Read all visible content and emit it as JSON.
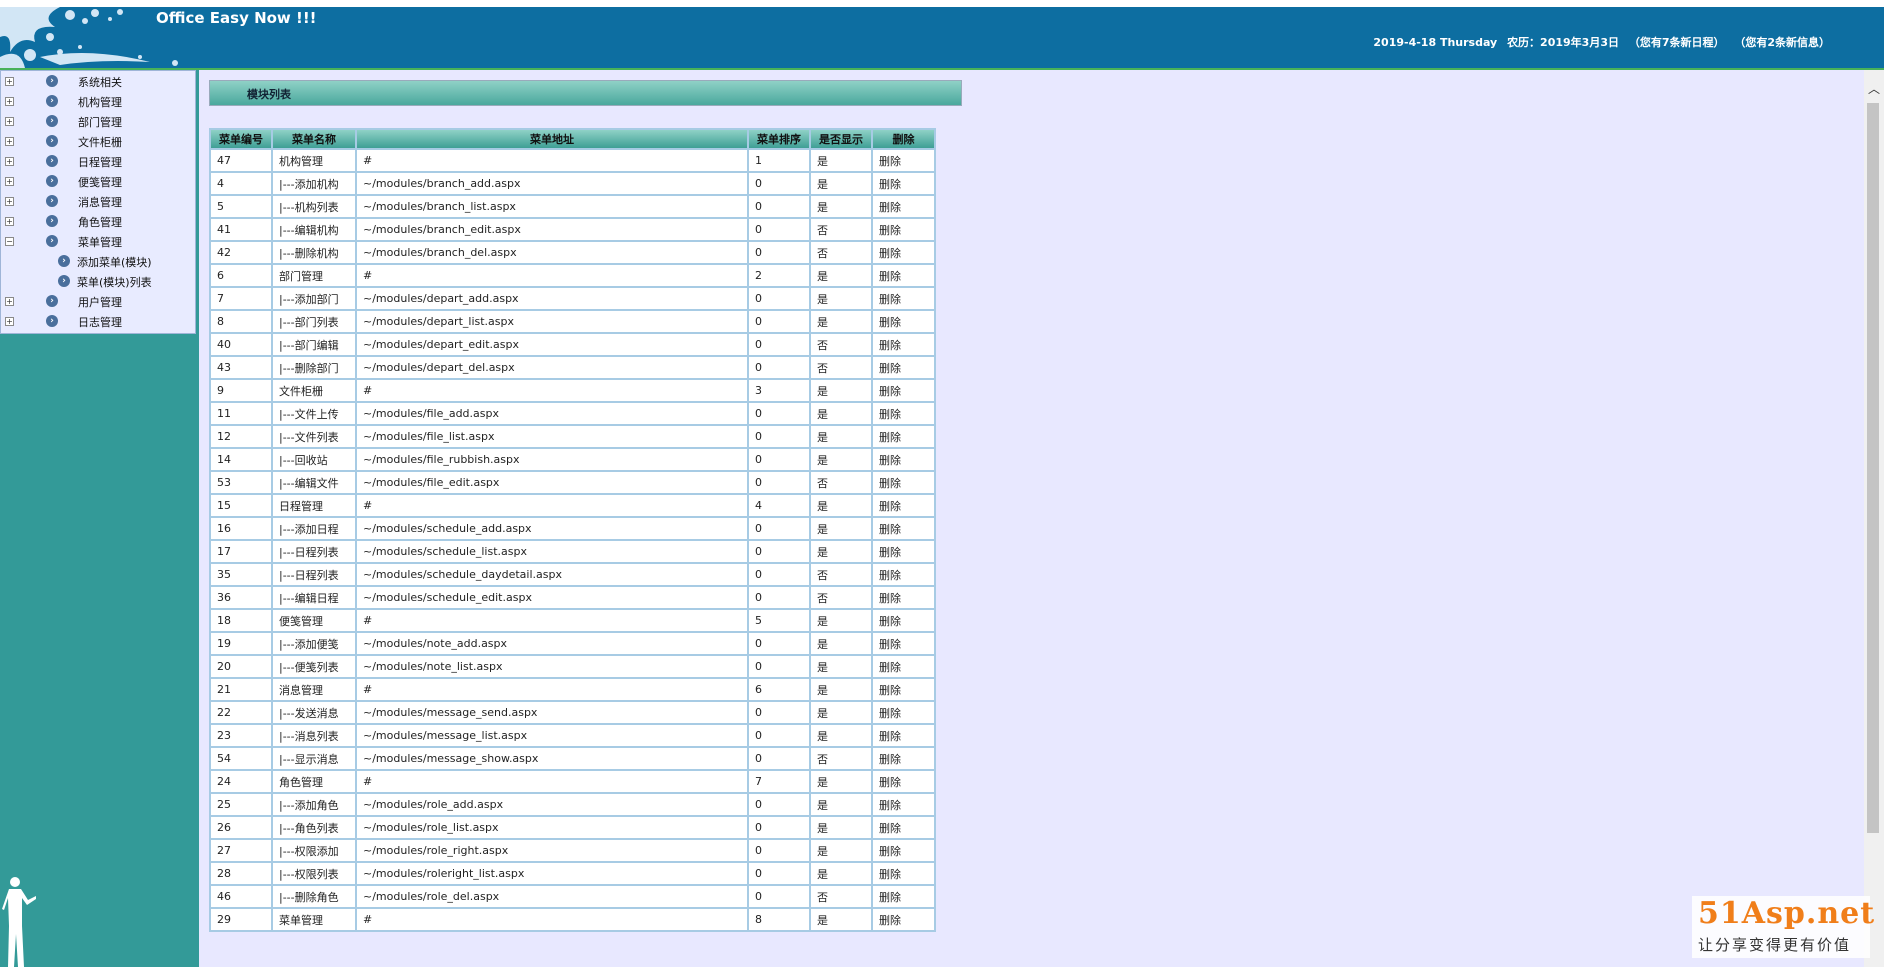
{
  "header": {
    "app_title": "Office Easy Now !!!",
    "date": "2019-4-18 Thursday",
    "lunar": "农历：2019年3月3日",
    "schedule_notice": "（您有7条新日程）",
    "message_notice": "（您有2条新信息）"
  },
  "sidebar": {
    "items": [
      {
        "label": "系统相关",
        "toggle": "+"
      },
      {
        "label": "机构管理",
        "toggle": "+"
      },
      {
        "label": "部门管理",
        "toggle": "+"
      },
      {
        "label": "文件柜栅",
        "toggle": "+"
      },
      {
        "label": "日程管理",
        "toggle": "+"
      },
      {
        "label": "便笺管理",
        "toggle": "+"
      },
      {
        "label": "消息管理",
        "toggle": "+"
      },
      {
        "label": "角色管理",
        "toggle": "+"
      },
      {
        "label": "菜单管理",
        "toggle": "−"
      },
      {
        "label": "添加菜单(模块)",
        "child": true
      },
      {
        "label": "菜单(模块)列表",
        "child": true
      },
      {
        "label": "用户管理",
        "toggle": "+"
      },
      {
        "label": "日志管理",
        "toggle": "+"
      }
    ]
  },
  "panel": {
    "title": "模块列表"
  },
  "table": {
    "headers": [
      "菜单编号",
      "菜单名称",
      "菜单地址",
      "菜单排序",
      "是否显示",
      "删除"
    ],
    "rows": [
      [
        "47",
        "机构管理",
        "#",
        "1",
        "是",
        "删除"
      ],
      [
        "4",
        "|---添加机构",
        "~/modules/branch_add.aspx",
        "0",
        "是",
        "删除"
      ],
      [
        "5",
        "|---机构列表",
        "~/modules/branch_list.aspx",
        "0",
        "是",
        "删除"
      ],
      [
        "41",
        "|---编辑机构",
        "~/modules/branch_edit.aspx",
        "0",
        "否",
        "删除"
      ],
      [
        "42",
        "|---删除机构",
        "~/modules/branch_del.aspx",
        "0",
        "否",
        "删除"
      ],
      [
        "6",
        "部门管理",
        "#",
        "2",
        "是",
        "删除"
      ],
      [
        "7",
        "|---添加部门",
        "~/modules/depart_add.aspx",
        "0",
        "是",
        "删除"
      ],
      [
        "8",
        "|---部门列表",
        "~/modules/depart_list.aspx",
        "0",
        "是",
        "删除"
      ],
      [
        "40",
        "|---部门编辑",
        "~/modules/depart_edit.aspx",
        "0",
        "否",
        "删除"
      ],
      [
        "43",
        "|---删除部门",
        "~/modules/depart_del.aspx",
        "0",
        "否",
        "删除"
      ],
      [
        "9",
        "文件柜栅",
        "#",
        "3",
        "是",
        "删除"
      ],
      [
        "11",
        "|---文件上传",
        "~/modules/file_add.aspx",
        "0",
        "是",
        "删除"
      ],
      [
        "12",
        "|---文件列表",
        "~/modules/file_list.aspx",
        "0",
        "是",
        "删除"
      ],
      [
        "14",
        "|---回收站",
        "~/modules/file_rubbish.aspx",
        "0",
        "是",
        "删除"
      ],
      [
        "53",
        "|---编辑文件",
        "~/modules/file_edit.aspx",
        "0",
        "否",
        "删除"
      ],
      [
        "15",
        "日程管理",
        "#",
        "4",
        "是",
        "删除"
      ],
      [
        "16",
        "|---添加日程",
        "~/modules/schedule_add.aspx",
        "0",
        "是",
        "删除"
      ],
      [
        "17",
        "|---日程列表",
        "~/modules/schedule_list.aspx",
        "0",
        "是",
        "删除"
      ],
      [
        "35",
        "|---日程列表",
        "~/modules/schedule_daydetail.aspx",
        "0",
        "否",
        "删除"
      ],
      [
        "36",
        "|---编辑日程",
        "~/modules/schedule_edit.aspx",
        "0",
        "否",
        "删除"
      ],
      [
        "18",
        "便笺管理",
        "#",
        "5",
        "是",
        "删除"
      ],
      [
        "19",
        "|---添加便笺",
        "~/modules/note_add.aspx",
        "0",
        "是",
        "删除"
      ],
      [
        "20",
        "|---便笺列表",
        "~/modules/note_list.aspx",
        "0",
        "是",
        "删除"
      ],
      [
        "21",
        "消息管理",
        "#",
        "6",
        "是",
        "删除"
      ],
      [
        "22",
        "|---发送消息",
        "~/modules/message_send.aspx",
        "0",
        "是",
        "删除"
      ],
      [
        "23",
        "|---消息列表",
        "~/modules/message_list.aspx",
        "0",
        "是",
        "删除"
      ],
      [
        "54",
        "|---显示消息",
        "~/modules/message_show.aspx",
        "0",
        "否",
        "删除"
      ],
      [
        "24",
        "角色管理",
        "#",
        "7",
        "是",
        "删除"
      ],
      [
        "25",
        "|---添加角色",
        "~/modules/role_add.aspx",
        "0",
        "是",
        "删除"
      ],
      [
        "26",
        "|---角色列表",
        "~/modules/role_list.aspx",
        "0",
        "是",
        "删除"
      ],
      [
        "27",
        "|---权限添加",
        "~/modules/role_right.aspx",
        "0",
        "是",
        "删除"
      ],
      [
        "28",
        "|---权限列表",
        "~/modules/roleright_list.aspx",
        "0",
        "是",
        "删除"
      ],
      [
        "46",
        "|---删除角色",
        "~/modules/role_del.aspx",
        "0",
        "否",
        "删除"
      ],
      [
        "29",
        "菜单管理",
        "#",
        "8",
        "是",
        "删除"
      ]
    ]
  },
  "watermark": {
    "brand": "51Asp.net",
    "slogan": "让分享变得更有价值"
  }
}
